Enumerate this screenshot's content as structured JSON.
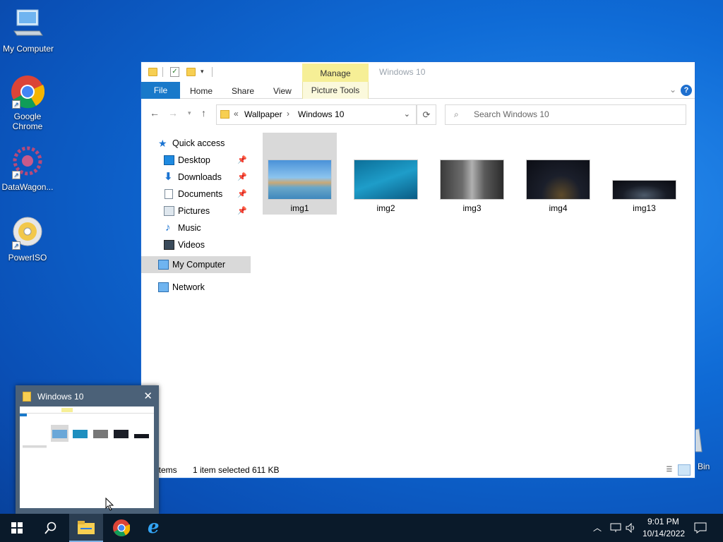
{
  "desktop": {
    "icons": [
      {
        "label": "My Computer",
        "icon": "computer-icon"
      },
      {
        "label": "Google Chrome",
        "icon": "chrome-icon"
      },
      {
        "label": "DataWagon...",
        "icon": "datawagon-icon"
      },
      {
        "label": "PowerISO",
        "icon": "poweriso-icon"
      }
    ],
    "recycle_label": "Bin"
  },
  "window": {
    "title": "Windows 10",
    "contextual_tab": "Manage",
    "ribbon_tabs": {
      "file": "File",
      "home": "Home",
      "share": "Share",
      "view": "View",
      "picture_tools": "Picture Tools"
    },
    "address": {
      "prefix": "«",
      "parts": [
        "Wallpaper",
        "Windows 10"
      ],
      "separator": "›"
    },
    "search": {
      "placeholder": "Search Windows 10"
    },
    "nav": {
      "quick_access": "Quick access",
      "items": [
        "Desktop",
        "Downloads",
        "Documents",
        "Pictures",
        "Music",
        "Videos"
      ],
      "my_computer": "My Computer",
      "network": "Network"
    },
    "files": [
      {
        "name": "img1"
      },
      {
        "name": "img2"
      },
      {
        "name": "img3"
      },
      {
        "name": "img4"
      },
      {
        "name": "img13"
      }
    ],
    "status": {
      "items": "items",
      "selection": "1 item selected",
      "size": "611 KB"
    }
  },
  "preview": {
    "title": "Windows 10",
    "close": "✕"
  },
  "taskbar": {
    "time": "9:01 PM",
    "date": "10/14/2022"
  },
  "colors": {
    "accent": "#1979ca",
    "manage": "#f6ef96",
    "taskbar": "#0a1a2a"
  }
}
